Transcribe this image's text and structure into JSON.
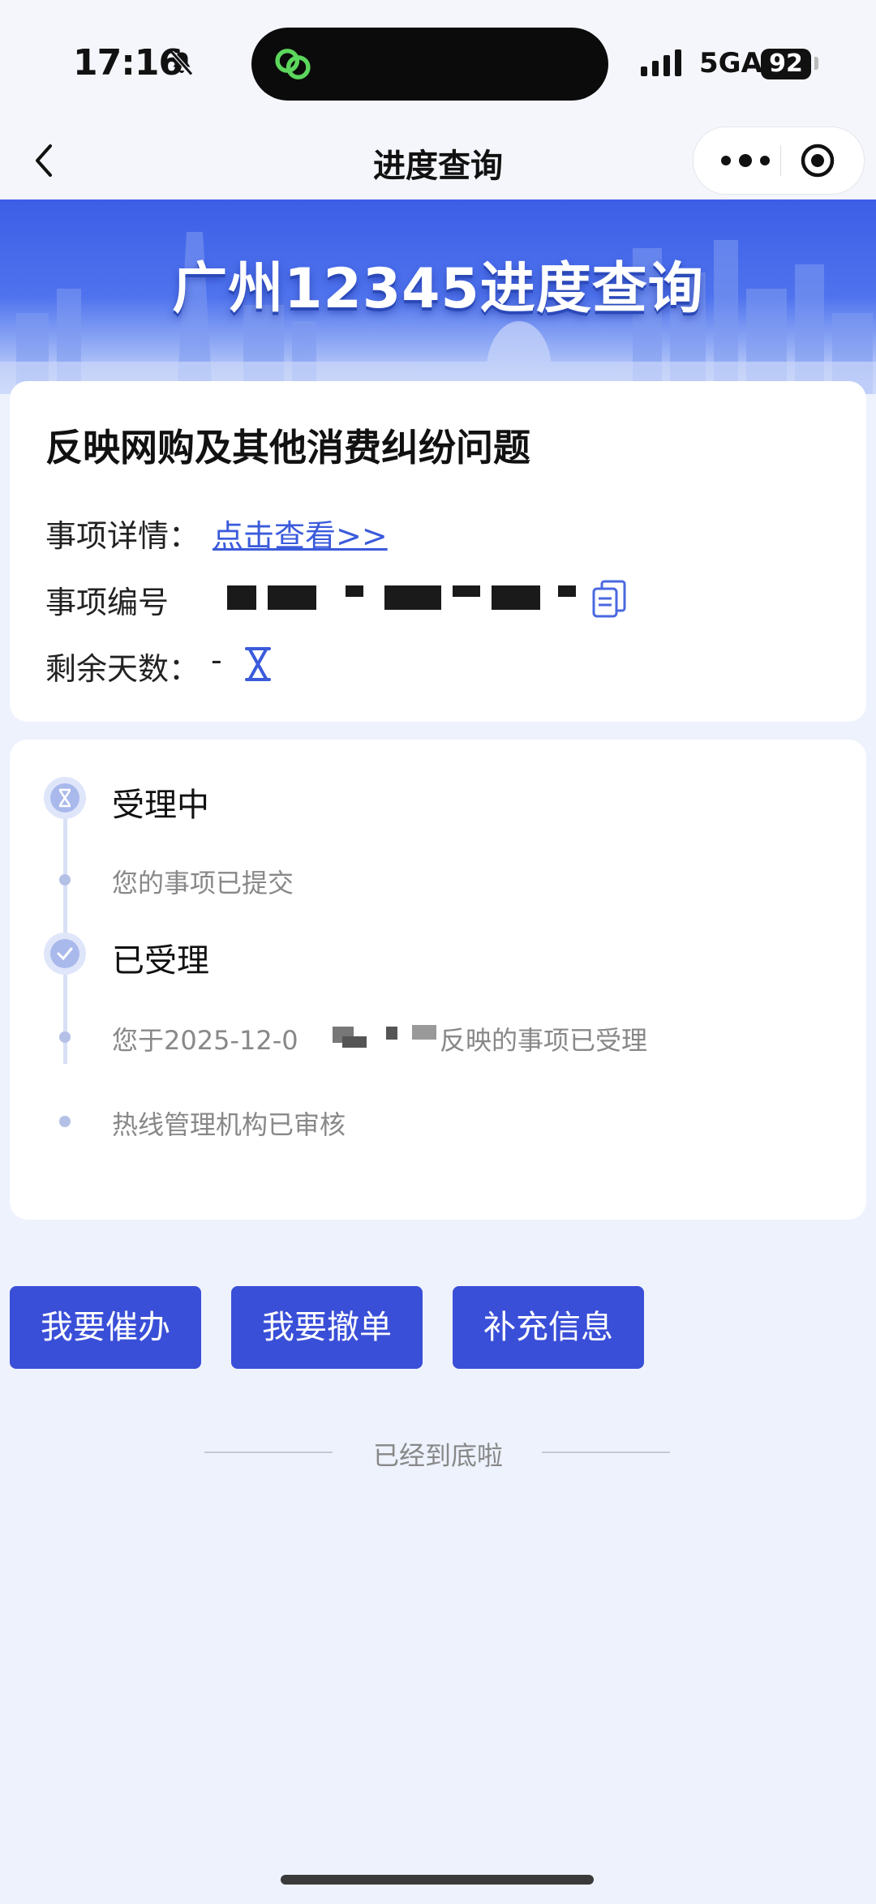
{
  "status_bar": {
    "time": "17:16",
    "network": "5GA",
    "battery": "92"
  },
  "nav": {
    "title": "进度查询"
  },
  "banner": {
    "title": "广州12345进度查询"
  },
  "issue": {
    "title": "反映网购及其他消费纠纷问题",
    "detail_label": "事项详情：",
    "detail_link": "点击查看>>",
    "number_label": "事项编号",
    "days_label": "剩余天数：",
    "days_value": "-"
  },
  "timeline": {
    "steps": [
      {
        "status": "受理中",
        "notes": [
          "您的事项已提交"
        ]
      },
      {
        "status": "已受理",
        "notes": [
          "您于2025-12-0",
          "反映的事项已受理",
          "热线管理机构已审核"
        ]
      }
    ]
  },
  "actions": {
    "urge": "我要催办",
    "withdraw": "我要撤单",
    "supplement": "补充信息"
  },
  "footer": {
    "end_text": "已经到底啦"
  },
  "colors": {
    "accent": "#3a4fd8",
    "link": "#3b5bdb",
    "page_bg": "#edf2fd"
  }
}
